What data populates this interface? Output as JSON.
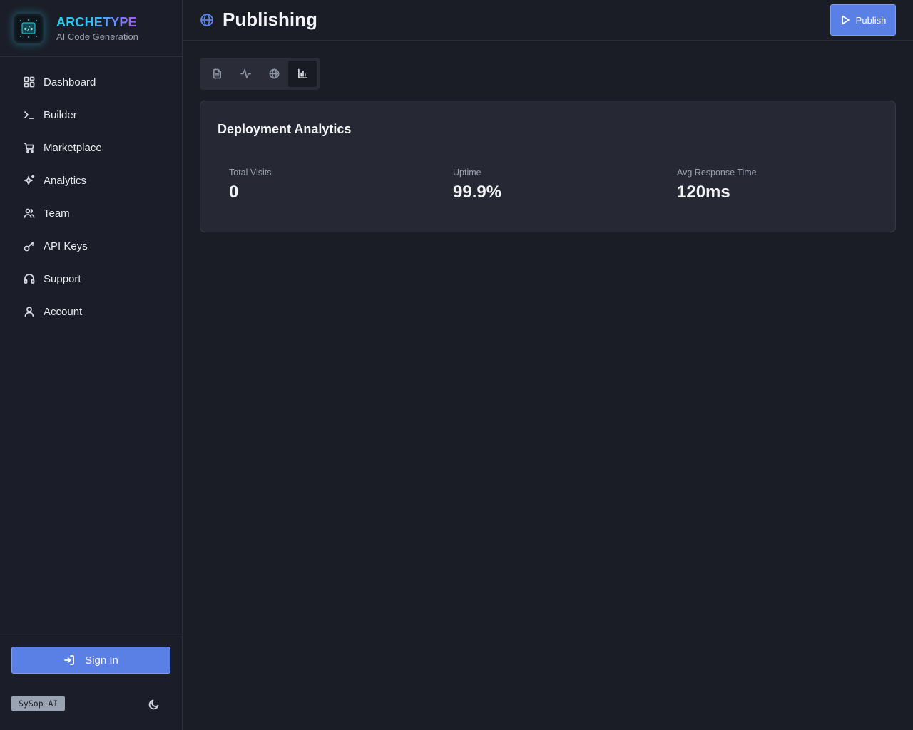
{
  "brand": {
    "name": "ARCHETYPE",
    "subtitle": "AI Code Generation",
    "logo_text": "</>"
  },
  "sidebar": {
    "items": [
      {
        "label": "Dashboard",
        "icon": "dashboard-icon"
      },
      {
        "label": "Builder",
        "icon": "terminal-icon"
      },
      {
        "label": "Marketplace",
        "icon": "cart-icon"
      },
      {
        "label": "Analytics",
        "icon": "sparkles-icon"
      },
      {
        "label": "Team",
        "icon": "users-icon"
      },
      {
        "label": "API Keys",
        "icon": "key-icon"
      },
      {
        "label": "Support",
        "icon": "headphones-icon"
      },
      {
        "label": "Account",
        "icon": "user-icon"
      }
    ],
    "sign_in_label": "Sign In",
    "badge": "SySop AI"
  },
  "header": {
    "title": "Publishing",
    "publish_label": "Publish"
  },
  "tabs": [
    {
      "icon": "file-icon",
      "active": false
    },
    {
      "icon": "activity-icon",
      "active": false
    },
    {
      "icon": "globe-icon",
      "active": false
    },
    {
      "icon": "bar-chart-icon",
      "active": true
    }
  ],
  "analytics": {
    "title": "Deployment Analytics",
    "stats": [
      {
        "label": "Total Visits",
        "value": "0"
      },
      {
        "label": "Uptime",
        "value": "99.9%"
      },
      {
        "label": "Avg Response Time",
        "value": "120ms"
      }
    ]
  },
  "colors": {
    "accent": "#5b80e5",
    "background": "#1a1d26",
    "card": "#262933"
  }
}
